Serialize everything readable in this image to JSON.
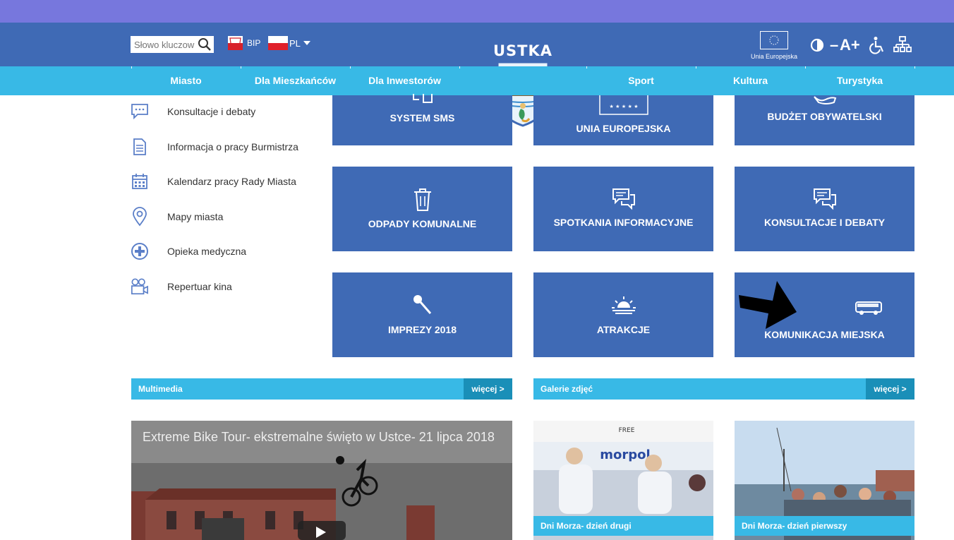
{
  "header": {
    "search_placeholder": "Słowo kluczow",
    "bip_label": "BIP",
    "lang_label": "PL",
    "eu_label": "Unia Europejska",
    "font_size_minus": "–",
    "font_size_label": "A+",
    "logo_text": "USTKA"
  },
  "nav": {
    "items": [
      "Miasto",
      "Dla Mieszkańców",
      "Dla Inwestorów",
      "Sport",
      "Kultura",
      "Turystyka"
    ]
  },
  "sidebar": {
    "items": [
      {
        "label": "Konsultacje i debaty",
        "icon": "chat-icon"
      },
      {
        "label": "Informacja o pracy Burmistrza",
        "icon": "document-icon"
      },
      {
        "label": "Kalendarz pracy Rady Miasta",
        "icon": "calendar-icon"
      },
      {
        "label": "Mapy miasta",
        "icon": "map-pin-icon"
      },
      {
        "label": "Opieka medyczna",
        "icon": "medical-cross-icon"
      },
      {
        "label": "Repertuar kina",
        "icon": "video-camera-icon"
      }
    ]
  },
  "tiles": [
    {
      "label": "SYSTEM SMS",
      "icon": "phone-message-icon"
    },
    {
      "label": "UNIA EUROPEJSKA",
      "icon": "eu-flag-icon"
    },
    {
      "label": "BUDŻET OBYWATELSKI",
      "icon": "hand-icon"
    },
    {
      "label": "ODPADY KOMUNALNE",
      "icon": "trash-icon"
    },
    {
      "label": "SPOTKANIA INFORMACYJNE",
      "icon": "speech-bubbles-icon"
    },
    {
      "label": "KONSULTACJE I DEBATY",
      "icon": "speech-bubbles-icon"
    },
    {
      "label": "IMPREZY 2018",
      "icon": "microphone-icon"
    },
    {
      "label": "ATRAKCJE",
      "icon": "sunset-icon"
    },
    {
      "label": "KOMUNIKACJA MIEJSKA",
      "icon": "bus-icon"
    }
  ],
  "sections": {
    "multimedia": {
      "title": "Multimedia",
      "more": "więcej >"
    },
    "gallery": {
      "title": "Galerie zdjęć",
      "more": "więcej >"
    }
  },
  "video": {
    "title": "Extreme Bike Tour- ekstremalne święto w Ustce- 21 lipca 2018"
  },
  "gallery": [
    {
      "caption": "Dni Morza- dzień drugi"
    },
    {
      "caption": "Dni Morza- dzień pierwszy"
    }
  ],
  "colors": {
    "top_strip": "#7777dd",
    "header_blue": "#3f6ab5",
    "nav_cyan": "#38b9e6",
    "more_button": "#1a8fb8"
  }
}
